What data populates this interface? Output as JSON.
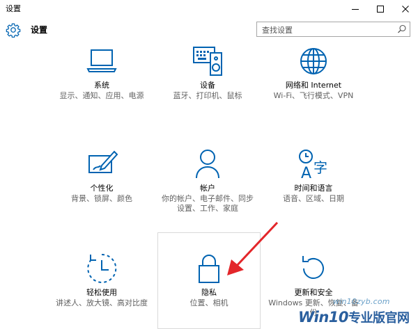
{
  "window": {
    "title": "设置",
    "controls": {
      "minimize": "minimize-icon",
      "maximize": "maximize-icon",
      "close": "close-icon"
    }
  },
  "header": {
    "title": "设置",
    "icon": "gear-icon",
    "search": {
      "placeholder": "查找设置",
      "icon": "search-icon"
    }
  },
  "accent_color": "#0063b1",
  "tiles": [
    {
      "name": "系统",
      "desc": "显示、通知、应用、电源",
      "icon": "laptop-icon"
    },
    {
      "name": "设备",
      "desc": "蓝牙、打印机、鼠标",
      "icon": "devices-icon"
    },
    {
      "name": "网络和 Internet",
      "desc": "Wi-Fi、飞行模式、VPN",
      "icon": "globe-icon"
    },
    {
      "name": "个性化",
      "desc": "背景、锁屏、颜色",
      "icon": "personalization-icon"
    },
    {
      "name": "帐户",
      "desc": "你的帐户、电子邮件、同步设置、工作、家庭",
      "icon": "person-icon"
    },
    {
      "name": "时间和语言",
      "desc": "语音、区域、日期",
      "icon": "time-language-icon"
    },
    {
      "name": "轻松使用",
      "desc": "讲述人、放大镜、高对比度",
      "icon": "ease-of-access-icon"
    },
    {
      "name": "隐私",
      "desc": "位置、相机",
      "icon": "lock-icon"
    },
    {
      "name": "更新和安全",
      "desc": "Windows 更新、恢复、备份",
      "icon": "update-icon"
    }
  ],
  "watermark": {
    "small": "win10zyb.com",
    "brand": "Win10",
    "suffix": "专业版官网"
  }
}
